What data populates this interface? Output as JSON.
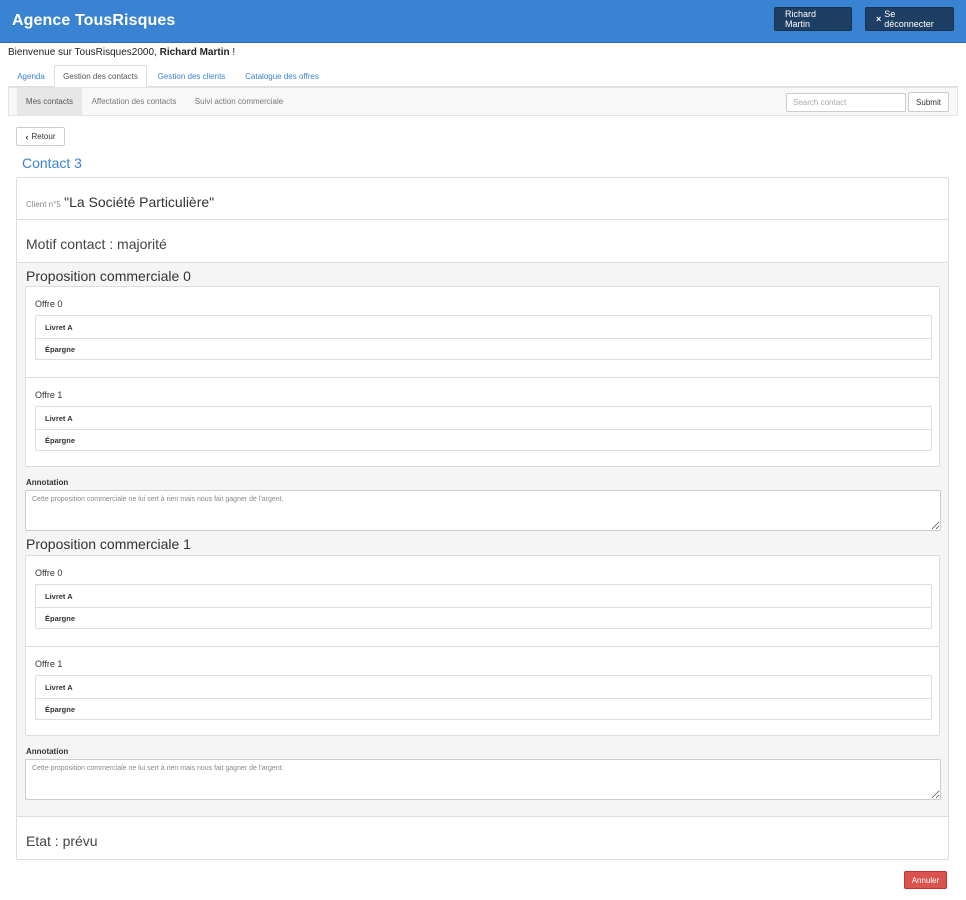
{
  "app": {
    "brand": "Agence TousRisques"
  },
  "header": {
    "user_button": "Richard Martin",
    "logout_label": "Se déconnecter",
    "logout_icon": "×"
  },
  "welcome": {
    "prefix": "Bienvenue sur TousRisques2000, ",
    "user": "Richard Martin",
    "suffix": " !"
  },
  "tabs": [
    "Agenda",
    "Gestion des contacts",
    "Gestion des clients",
    "Catalogue des offres"
  ],
  "active_tab": "Gestion des contacts",
  "subnav": {
    "items": [
      "Mes contacts",
      "Affectation des contacts",
      "Suivi action commerciale"
    ],
    "search_placeholder": "Search contact",
    "submit_label": "Submit"
  },
  "back_label": "Retour",
  "contact": {
    "title": "Contact 3",
    "client_label": "Client n°5",
    "client_name": "\"La Société Particulière\"",
    "motif": "Motif contact : majorité",
    "etat": "Etat : prévu",
    "propositions": [
      {
        "title": "Proposition commerciale 0",
        "offers": [
          {
            "name": "Offre 0",
            "items": [
              "Livret A",
              "Épargne"
            ]
          },
          {
            "name": "Offre 1",
            "items": [
              "Livret A",
              "Épargne"
            ]
          }
        ],
        "annotation_label": "Annotation",
        "annotation": "Cette proposition commerciale ne lui sert à rien mais nous fait gagner de l'argent."
      },
      {
        "title": "Proposition commerciale 1",
        "offers": [
          {
            "name": "Offre 0",
            "items": [
              "Livret A",
              "Épargne"
            ]
          },
          {
            "name": "Offre 1",
            "items": [
              "Livret A",
              "Épargne"
            ]
          }
        ],
        "annotation_label": "Annotation",
        "annotation": "Cette proposition commerciale ne lui sert à rien mais nous fait gagner de l'argent."
      }
    ]
  },
  "cancel_label": "Annuler",
  "colors": {
    "primary": "#3a83d3",
    "dark_button": "#1f3e63",
    "danger": "#d9534f"
  }
}
